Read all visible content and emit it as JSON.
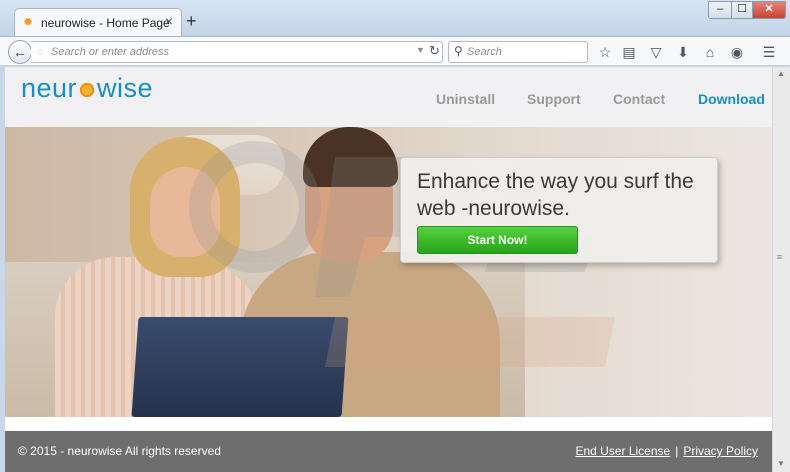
{
  "browser": {
    "tab_title": "neurowise - Home Page",
    "tab_close": "×",
    "new_tab": "+",
    "url_placeholder": "Search or enter address",
    "search_placeholder": "Search",
    "window_buttons": {
      "minimize": "–",
      "maximize": "☐",
      "close": "✕"
    }
  },
  "site": {
    "logo": {
      "part1": "neur",
      "part2": "wise"
    },
    "nav": [
      {
        "label": "Uninstall",
        "active": false
      },
      {
        "label": "Support",
        "active": false
      },
      {
        "label": "Contact",
        "active": false
      },
      {
        "label": "Download",
        "active": true
      }
    ],
    "hero": {
      "heading": "Enhance the way you surf the web -neurowise.",
      "cta": "Start Now!"
    },
    "footer": {
      "copyright": "© 2015 - neurowise All rights reserved",
      "links": [
        "End User License",
        "Privacy Policy"
      ],
      "separator": "|"
    }
  },
  "colors": {
    "brand_blue": "#1a8dc5",
    "cta_green": "#2fb324",
    "footer_gray": "#6e6e6e"
  },
  "icons": [
    "firefox-tab-icon",
    "back-icon",
    "reload-icon",
    "search-icon",
    "bookmark-star-icon",
    "reading-list-icon",
    "pocket-icon",
    "download-icon",
    "home-icon",
    "chat-icon",
    "menu-icon"
  ]
}
